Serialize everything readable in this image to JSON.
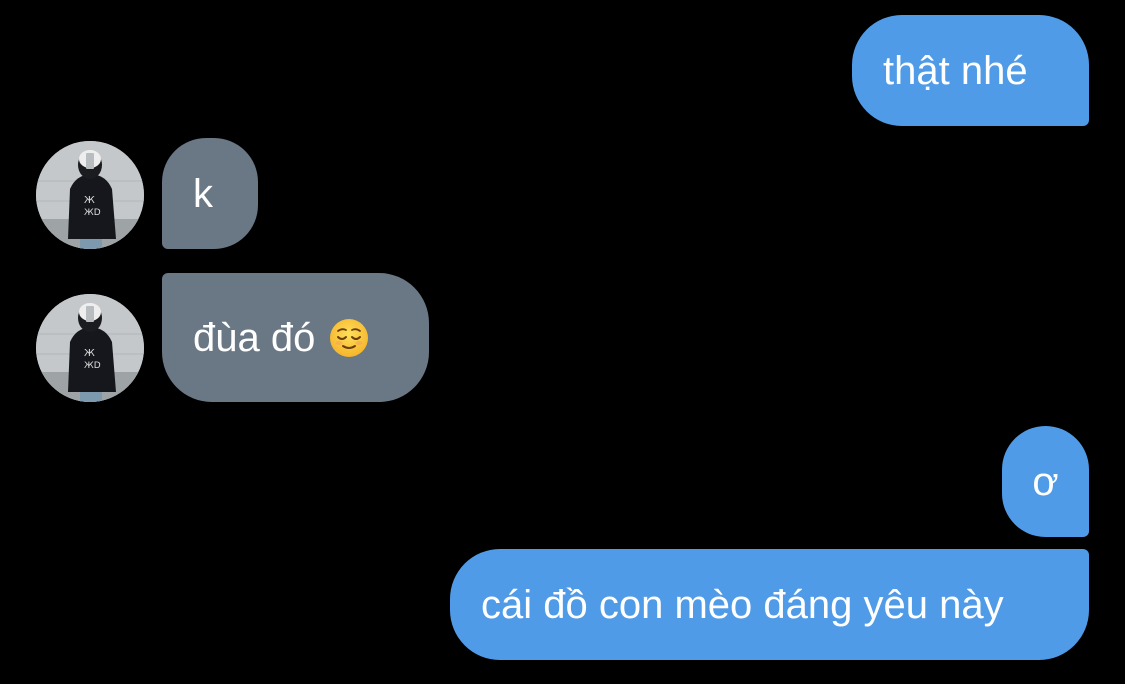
{
  "conversation": {
    "messages": [
      {
        "direction": "sent",
        "text": "thật nhé"
      },
      {
        "direction": "received",
        "text": "k",
        "avatar_icon": "user-avatar"
      },
      {
        "direction": "received",
        "text": "đùa đó",
        "emoji_icon": "relieved-face-emoji",
        "avatar_icon": "user-avatar"
      },
      {
        "direction": "sent",
        "text": "ơ"
      },
      {
        "direction": "sent",
        "text": "cái đồ con mèo đáng yêu này"
      }
    ]
  },
  "colors": {
    "background": "#000000",
    "sent_bubble": "#4f9be8",
    "received_bubble": "#6a7784",
    "text": "#ffffff"
  }
}
